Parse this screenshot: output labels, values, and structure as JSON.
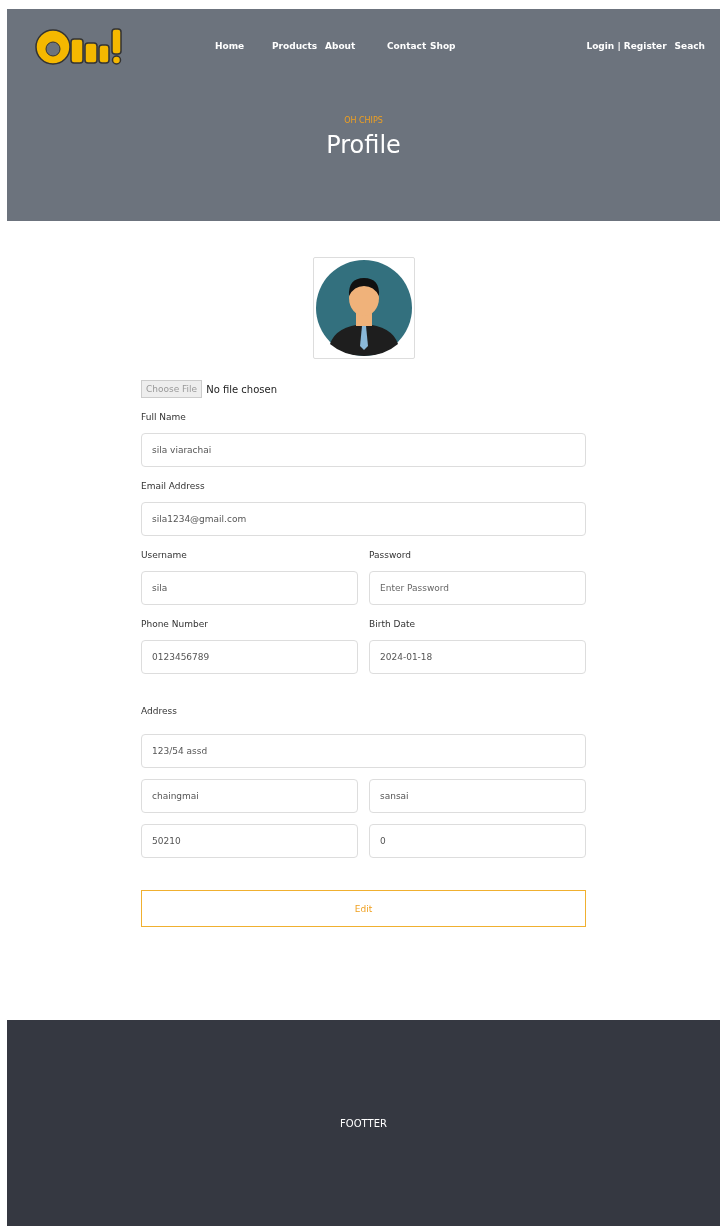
{
  "nav": {
    "links": [
      "Home",
      "Products",
      "About",
      "Contact",
      "Shop"
    ],
    "account": "Login | Register",
    "search": "Seach"
  },
  "hero": {
    "kicker": "OH CHIPS",
    "title": "Profile"
  },
  "file": {
    "button": "Choose File",
    "status": "No file chosen"
  },
  "fields": [
    {
      "label": "Full Name",
      "value": "sila viarachai"
    },
    {
      "label": "Email Address",
      "value": "sila1234@gmail.com"
    },
    {
      "label": "Username",
      "value": "sila"
    },
    {
      "label": "Password",
      "placeholder": "Enter Password"
    },
    {
      "label": "Phone Number",
      "value": "0123456789"
    },
    {
      "label": "Birth Date",
      "value": "2024-01-18"
    }
  ],
  "address": {
    "label": "Address",
    "fields": [
      "123/54 assd",
      "chaingmai",
      "sansai",
      "50210",
      "0"
    ]
  },
  "submit": "Edit",
  "footer": "FOOTTER"
}
